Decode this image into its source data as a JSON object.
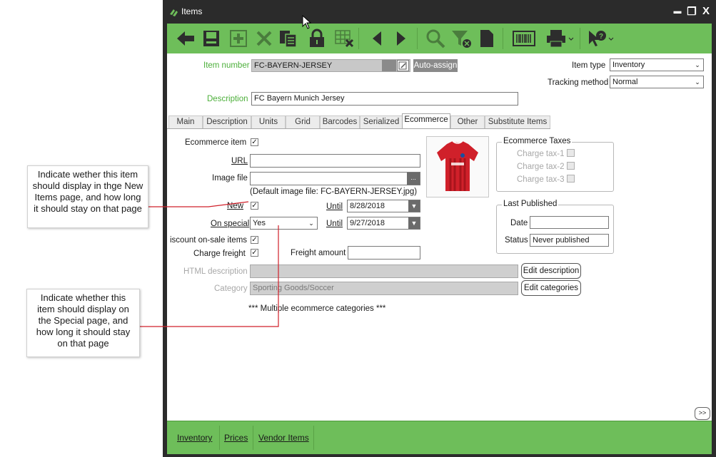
{
  "window": {
    "title": "Items",
    "minimize": "▬",
    "restore": "❐",
    "close": "X"
  },
  "toolbar": {
    "icons": [
      "back-arrow-icon",
      "save-icon",
      "add-icon",
      "delete-icon",
      "copy-icon",
      "lock-icon",
      "grid-delete-icon",
      "previous-icon",
      "next-icon",
      "search-icon",
      "filter-clear-icon",
      "document-icon",
      "barcode-icon",
      "print-icon",
      "help-pointer-icon"
    ]
  },
  "header": {
    "item_number_label": "Item number",
    "item_number_value": "FC-BAYERN-JERSEY",
    "auto_assign_label": "Auto-assign",
    "item_type_label": "Item type",
    "item_type_value": "Inventory",
    "tracking_method_label": "Tracking method",
    "tracking_method_value": "Normal",
    "description_label": "Description",
    "description_value": "FC Bayern Munich Jersey"
  },
  "tabs": [
    "Main",
    "Description",
    "Units",
    "Grid",
    "Barcodes",
    "Serialized",
    "Ecommerce",
    "Other",
    "Substitute Items"
  ],
  "active_tab": "Ecommerce",
  "ecommerce": {
    "ecommerce_item_label": "Ecommerce item",
    "ecommerce_item_checked": "✓",
    "url_label": "URL",
    "url_value": "",
    "image_file_label": "Image file",
    "image_file_value": "",
    "image_browse": "...",
    "default_image_note": "(Default image file: FC-BAYERN-JERSEY.jpg)",
    "new_label": "New",
    "new_checked": "✓",
    "until_label": "Until",
    "new_until_value": "8/28/2018",
    "on_special_label": "On special",
    "on_special_value": "Yes",
    "special_until_value": "9/27/2018",
    "discount_label": "iscount on-sale items",
    "discount_checked": "✓",
    "charge_freight_label": "Charge freight",
    "charge_freight_checked": "✓",
    "freight_amount_label": "Freight amount",
    "freight_amount_value": "",
    "html_description_label": "HTML description",
    "html_description_value": "",
    "edit_description_label": "Edit description",
    "category_label": "Category",
    "category_value": "Sporting Goods/Soccer",
    "edit_categories_label": "Edit categories",
    "multiple_categories_note": "*** Multiple ecommerce categories ***"
  },
  "taxes": {
    "title": "Ecommerce Taxes",
    "items": [
      "Charge tax-1",
      "Charge tax-2",
      "Charge tax-3"
    ]
  },
  "last_published": {
    "title": "Last Published",
    "date_label": "Date",
    "date_value": "",
    "status_label": "Status",
    "status_value": "Never published"
  },
  "more_button": ">>",
  "bottom_nav": [
    "Inventory",
    "Prices",
    "Vendor Items"
  ],
  "callouts": {
    "new_items": "Indicate wether this item should display in thge New Items page, and how long it should stay on that page",
    "special": "Indicate whether this item should display on the Special page, and how long it should stay on that page"
  },
  "colors": {
    "toolbar_green": "#6ebe5a",
    "title_bar": "#2b2b2b",
    "label_green": "#4caf3a",
    "callout_line": "#d0202a"
  }
}
